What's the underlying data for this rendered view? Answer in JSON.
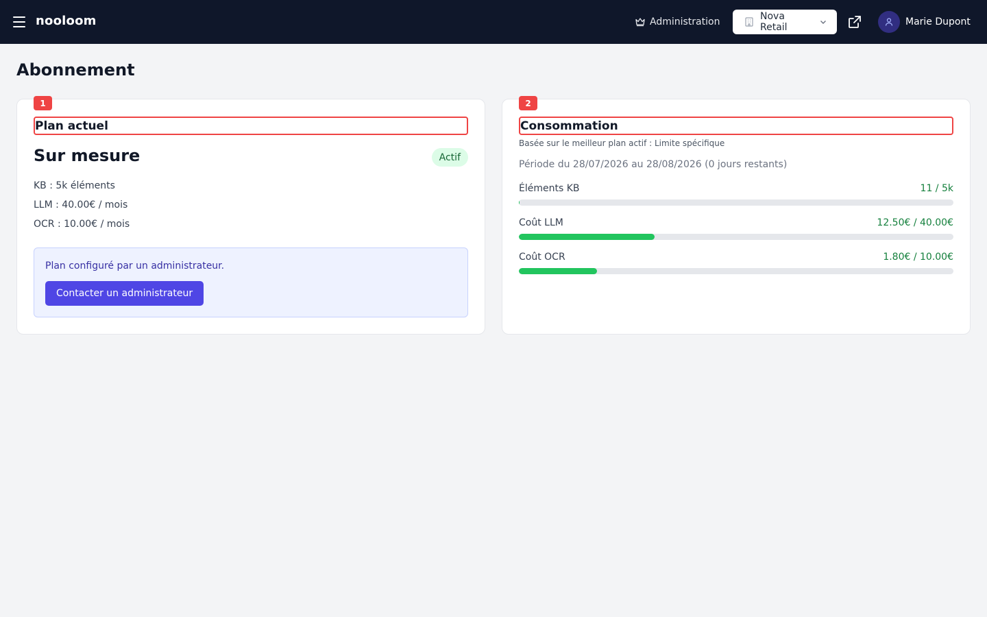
{
  "header": {
    "brand": "nooloom",
    "admin_label": "Administration",
    "org_selected": "Nova Retail",
    "user_name": "Marie Dupont"
  },
  "page": {
    "title": "Abonnement"
  },
  "plan_card": {
    "badge": "1",
    "heading": "Plan actuel",
    "plan_name": "Sur mesure",
    "status": "Actif",
    "features": [
      "KB : 5k éléments",
      "LLM : 40.00€ / mois",
      "OCR : 10.00€ / mois"
    ],
    "info_text": "Plan configuré par un administrateur.",
    "contact_button": "Contacter un administrateur"
  },
  "usage_card": {
    "badge": "2",
    "heading": "Consommation",
    "subtitle": "Basée sur le meilleur plan actif : Limite spécifique",
    "period": "Période du 28/07/2026 au 28/08/2026 (0 jours restants)",
    "items": [
      {
        "label": "Éléments KB",
        "value": "11 / 5k",
        "fraction": 0.0022
      },
      {
        "label": "Coût LLM",
        "value": "12.50€ / 40.00€",
        "fraction": 0.3125
      },
      {
        "label": "Coût OCR",
        "value": "1.80€ / 10.00€",
        "fraction": 0.18
      }
    ]
  },
  "colors": {
    "topbar": "#0f172a",
    "accent": "#4f46e5",
    "success": "#22c55e",
    "highlight": "#ef4444"
  }
}
